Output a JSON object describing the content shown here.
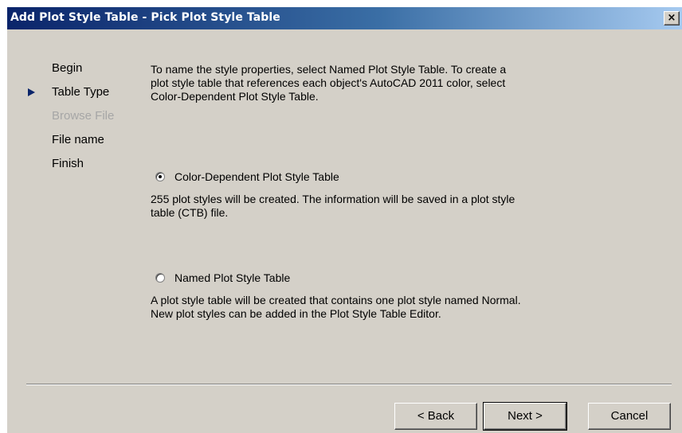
{
  "window": {
    "title": "Add Plot Style Table - Pick Plot Style Table",
    "close_label": "×"
  },
  "steps": [
    {
      "label": "Begin",
      "state": "normal"
    },
    {
      "label": "Table Type",
      "state": "current"
    },
    {
      "label": "Browse File",
      "state": "disabled"
    },
    {
      "label": "File name",
      "state": "normal"
    },
    {
      "label": "Finish",
      "state": "normal"
    }
  ],
  "intro_text": "To name the style properties, select Named Plot Style Table. To create a plot style table that references each object's AutoCAD 2011 color, select Color-Dependent Plot Style Table.",
  "options": {
    "color_dependent": {
      "label": "Color-Dependent Plot Style Table",
      "selected": true,
      "description": "255 plot styles will be created. The information will be saved in a plot style table (CTB) file."
    },
    "named": {
      "label": "Named Plot Style Table",
      "selected": false,
      "description": "A plot style table will be created that contains one plot style named Normal.  New plot styles can be added in the Plot Style Table Editor."
    }
  },
  "buttons": {
    "back": "< Back",
    "next": "Next >",
    "cancel": "Cancel"
  },
  "colors": {
    "title_bar_start": "#0a246a",
    "title_bar_end": "#a6caf0",
    "dialog_face": "#d4d0c8",
    "current_step_arrow": "#0a246a",
    "disabled_text": "#a6a6a6"
  }
}
